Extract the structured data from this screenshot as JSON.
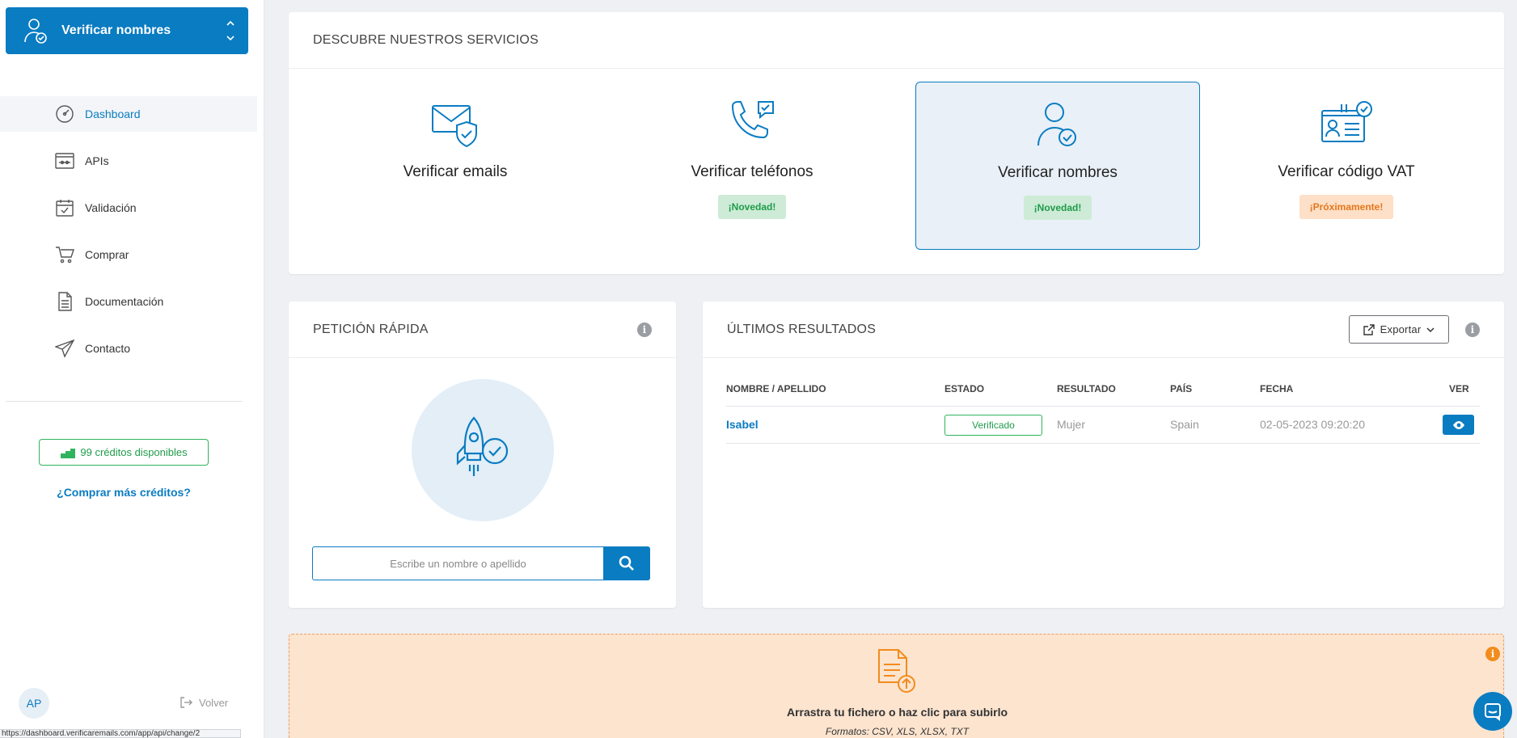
{
  "sidebar": {
    "switcher_label": "Verificar nombres",
    "nav": [
      {
        "label": "Dashboard",
        "icon": "gauge-icon",
        "active": true
      },
      {
        "label": "APIs",
        "icon": "api-icon"
      },
      {
        "label": "Validación",
        "icon": "calendar-check-icon"
      },
      {
        "label": "Comprar",
        "icon": "cart-icon"
      },
      {
        "label": "Documentación",
        "icon": "document-icon"
      },
      {
        "label": "Contacto",
        "icon": "paper-plane-icon"
      }
    ],
    "credits": "99 créditos disponibles",
    "buy_more": "¿Comprar más créditos?",
    "avatar": "AP",
    "logout": "Volver",
    "status_url": "https://dashboard.verificaremails.com/app/api/change/2"
  },
  "services": {
    "title": "DESCUBRE NUESTROS SERVICIOS",
    "items": [
      {
        "label": "Verificar emails",
        "badge": ""
      },
      {
        "label": "Verificar teléfonos",
        "badge": "¡Novedad!"
      },
      {
        "label": "Verificar nombres",
        "badge": "¡Novedad!",
        "selected": true
      },
      {
        "label": "Verificar código VAT",
        "badge": "¡Próximamente!"
      }
    ]
  },
  "quick": {
    "title": "PETICIÓN RÁPIDA",
    "placeholder": "Escribe un nombre o apellido"
  },
  "results": {
    "title": "ÚLTIMOS RESULTADOS",
    "export": "Exportar",
    "columns": [
      "NOMBRE / APELLIDO",
      "ESTADO",
      "RESULTADO",
      "PAÍS",
      "FECHA",
      "VER"
    ],
    "rows": [
      {
        "name": "Isabel",
        "status": "Verificado",
        "result": "Mujer",
        "country": "Spain",
        "date": "02-05-2023 09:20:20"
      }
    ]
  },
  "upload": {
    "text": "Arrastra tu fichero o haz clic para subirlo",
    "formats": "Formatos: CSV, XLS, XLSX, TXT"
  },
  "colors": {
    "primary": "#0a7cc2",
    "success": "#2fb35c",
    "warning": "#f28c1c",
    "upload_bg": "#fce4cf"
  }
}
